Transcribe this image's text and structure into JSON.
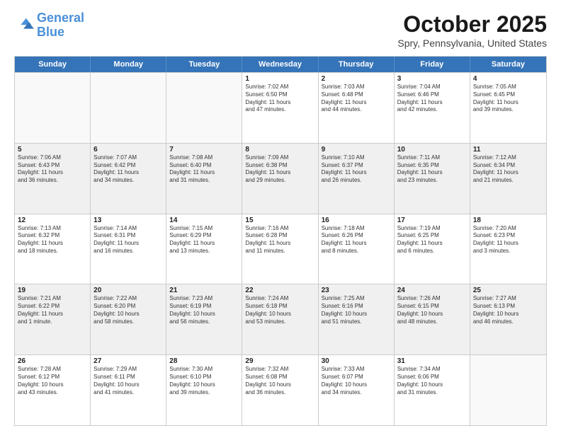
{
  "header": {
    "logo_line1": "General",
    "logo_line2": "Blue",
    "title": "October 2025",
    "subtitle": "Spry, Pennsylvania, United States"
  },
  "days_of_week": [
    "Sunday",
    "Monday",
    "Tuesday",
    "Wednesday",
    "Thursday",
    "Friday",
    "Saturday"
  ],
  "rows": [
    [
      {
        "num": "",
        "lines": [],
        "empty": true
      },
      {
        "num": "",
        "lines": [],
        "empty": true
      },
      {
        "num": "",
        "lines": [],
        "empty": true
      },
      {
        "num": "1",
        "lines": [
          "Sunrise: 7:02 AM",
          "Sunset: 6:50 PM",
          "Daylight: 11 hours",
          "and 47 minutes."
        ]
      },
      {
        "num": "2",
        "lines": [
          "Sunrise: 7:03 AM",
          "Sunset: 6:48 PM",
          "Daylight: 11 hours",
          "and 44 minutes."
        ]
      },
      {
        "num": "3",
        "lines": [
          "Sunrise: 7:04 AM",
          "Sunset: 6:46 PM",
          "Daylight: 11 hours",
          "and 42 minutes."
        ]
      },
      {
        "num": "4",
        "lines": [
          "Sunrise: 7:05 AM",
          "Sunset: 6:45 PM",
          "Daylight: 11 hours",
          "and 39 minutes."
        ]
      }
    ],
    [
      {
        "num": "5",
        "lines": [
          "Sunrise: 7:06 AM",
          "Sunset: 6:43 PM",
          "Daylight: 11 hours",
          "and 36 minutes."
        ],
        "shaded": true
      },
      {
        "num": "6",
        "lines": [
          "Sunrise: 7:07 AM",
          "Sunset: 6:42 PM",
          "Daylight: 11 hours",
          "and 34 minutes."
        ],
        "shaded": true
      },
      {
        "num": "7",
        "lines": [
          "Sunrise: 7:08 AM",
          "Sunset: 6:40 PM",
          "Daylight: 11 hours",
          "and 31 minutes."
        ],
        "shaded": true
      },
      {
        "num": "8",
        "lines": [
          "Sunrise: 7:09 AM",
          "Sunset: 6:38 PM",
          "Daylight: 11 hours",
          "and 29 minutes."
        ],
        "shaded": true
      },
      {
        "num": "9",
        "lines": [
          "Sunrise: 7:10 AM",
          "Sunset: 6:37 PM",
          "Daylight: 11 hours",
          "and 26 minutes."
        ],
        "shaded": true
      },
      {
        "num": "10",
        "lines": [
          "Sunrise: 7:11 AM",
          "Sunset: 6:35 PM",
          "Daylight: 11 hours",
          "and 23 minutes."
        ],
        "shaded": true
      },
      {
        "num": "11",
        "lines": [
          "Sunrise: 7:12 AM",
          "Sunset: 6:34 PM",
          "Daylight: 11 hours",
          "and 21 minutes."
        ],
        "shaded": true
      }
    ],
    [
      {
        "num": "12",
        "lines": [
          "Sunrise: 7:13 AM",
          "Sunset: 6:32 PM",
          "Daylight: 11 hours",
          "and 18 minutes."
        ]
      },
      {
        "num": "13",
        "lines": [
          "Sunrise: 7:14 AM",
          "Sunset: 6:31 PM",
          "Daylight: 11 hours",
          "and 16 minutes."
        ]
      },
      {
        "num": "14",
        "lines": [
          "Sunrise: 7:15 AM",
          "Sunset: 6:29 PM",
          "Daylight: 11 hours",
          "and 13 minutes."
        ]
      },
      {
        "num": "15",
        "lines": [
          "Sunrise: 7:16 AM",
          "Sunset: 6:28 PM",
          "Daylight: 11 hours",
          "and 11 minutes."
        ]
      },
      {
        "num": "16",
        "lines": [
          "Sunrise: 7:18 AM",
          "Sunset: 6:26 PM",
          "Daylight: 11 hours",
          "and 8 minutes."
        ]
      },
      {
        "num": "17",
        "lines": [
          "Sunrise: 7:19 AM",
          "Sunset: 6:25 PM",
          "Daylight: 11 hours",
          "and 6 minutes."
        ]
      },
      {
        "num": "18",
        "lines": [
          "Sunrise: 7:20 AM",
          "Sunset: 6:23 PM",
          "Daylight: 11 hours",
          "and 3 minutes."
        ]
      }
    ],
    [
      {
        "num": "19",
        "lines": [
          "Sunrise: 7:21 AM",
          "Sunset: 6:22 PM",
          "Daylight: 11 hours",
          "and 1 minute."
        ],
        "shaded": true
      },
      {
        "num": "20",
        "lines": [
          "Sunrise: 7:22 AM",
          "Sunset: 6:20 PM",
          "Daylight: 10 hours",
          "and 58 minutes."
        ],
        "shaded": true
      },
      {
        "num": "21",
        "lines": [
          "Sunrise: 7:23 AM",
          "Sunset: 6:19 PM",
          "Daylight: 10 hours",
          "and 56 minutes."
        ],
        "shaded": true
      },
      {
        "num": "22",
        "lines": [
          "Sunrise: 7:24 AM",
          "Sunset: 6:18 PM",
          "Daylight: 10 hours",
          "and 53 minutes."
        ],
        "shaded": true
      },
      {
        "num": "23",
        "lines": [
          "Sunrise: 7:25 AM",
          "Sunset: 6:16 PM",
          "Daylight: 10 hours",
          "and 51 minutes."
        ],
        "shaded": true
      },
      {
        "num": "24",
        "lines": [
          "Sunrise: 7:26 AM",
          "Sunset: 6:15 PM",
          "Daylight: 10 hours",
          "and 48 minutes."
        ],
        "shaded": true
      },
      {
        "num": "25",
        "lines": [
          "Sunrise: 7:27 AM",
          "Sunset: 6:13 PM",
          "Daylight: 10 hours",
          "and 46 minutes."
        ],
        "shaded": true
      }
    ],
    [
      {
        "num": "26",
        "lines": [
          "Sunrise: 7:28 AM",
          "Sunset: 6:12 PM",
          "Daylight: 10 hours",
          "and 43 minutes."
        ]
      },
      {
        "num": "27",
        "lines": [
          "Sunrise: 7:29 AM",
          "Sunset: 6:11 PM",
          "Daylight: 10 hours",
          "and 41 minutes."
        ]
      },
      {
        "num": "28",
        "lines": [
          "Sunrise: 7:30 AM",
          "Sunset: 6:10 PM",
          "Daylight: 10 hours",
          "and 39 minutes."
        ]
      },
      {
        "num": "29",
        "lines": [
          "Sunrise: 7:32 AM",
          "Sunset: 6:08 PM",
          "Daylight: 10 hours",
          "and 36 minutes."
        ]
      },
      {
        "num": "30",
        "lines": [
          "Sunrise: 7:33 AM",
          "Sunset: 6:07 PM",
          "Daylight: 10 hours",
          "and 34 minutes."
        ]
      },
      {
        "num": "31",
        "lines": [
          "Sunrise: 7:34 AM",
          "Sunset: 6:06 PM",
          "Daylight: 10 hours",
          "and 31 minutes."
        ]
      },
      {
        "num": "",
        "lines": [],
        "empty": true
      }
    ]
  ]
}
